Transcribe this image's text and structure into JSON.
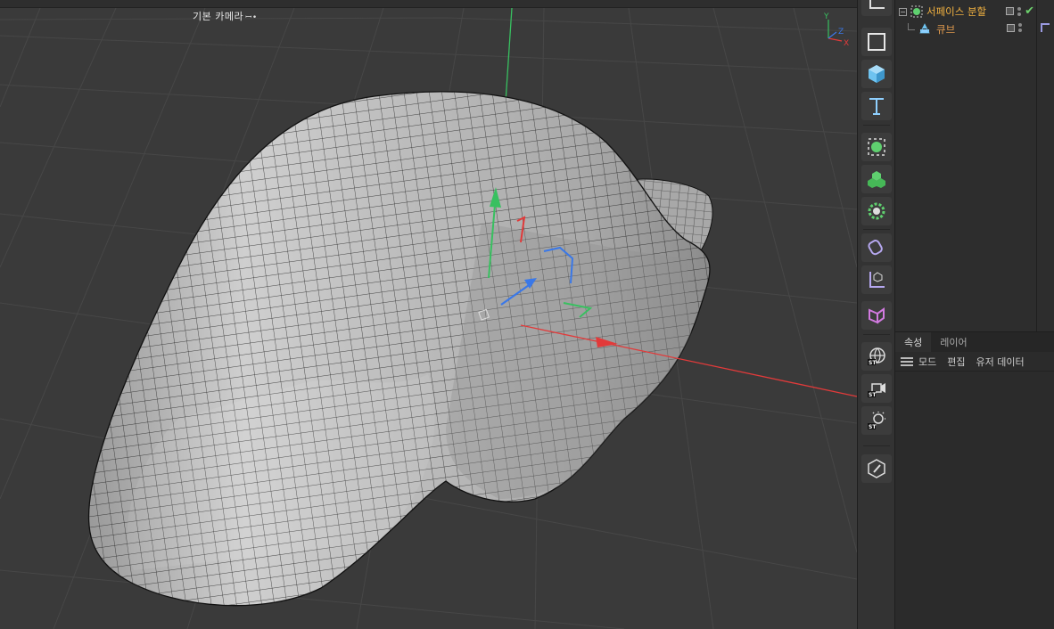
{
  "viewport": {
    "camera_label": "기본 카메라",
    "camera_icon": "ꟷ•"
  },
  "toolbar": {
    "tools": [
      {
        "name": "coordinate-icon"
      },
      {
        "name": "square-icon"
      },
      {
        "name": "cube-icon"
      },
      {
        "name": "text-icon"
      },
      {
        "name": "subdivision-surface-icon"
      },
      {
        "name": "cloner-icon"
      },
      {
        "name": "effector-icon"
      },
      {
        "name": "deformer-icon"
      },
      {
        "name": "null-object-icon"
      },
      {
        "name": "perspective-icon"
      },
      {
        "name": "environment-icon"
      },
      {
        "name": "camera-icon"
      },
      {
        "name": "light-icon"
      },
      {
        "name": "edit-icon"
      }
    ]
  },
  "objects": {
    "items": [
      {
        "label": "서페이스 분할",
        "color": "#f0b040"
      },
      {
        "label": "큐브",
        "color": "#e09a4e"
      }
    ]
  },
  "attributes": {
    "tabs": [
      "속성",
      "레이어"
    ],
    "menu": [
      "모드",
      "편집",
      "유저 데이터"
    ]
  },
  "colors": {
    "x_axis": "#e23a3a",
    "y_axis": "#38c060",
    "z_axis": "#3a78e8",
    "accent": "#f0b040"
  }
}
